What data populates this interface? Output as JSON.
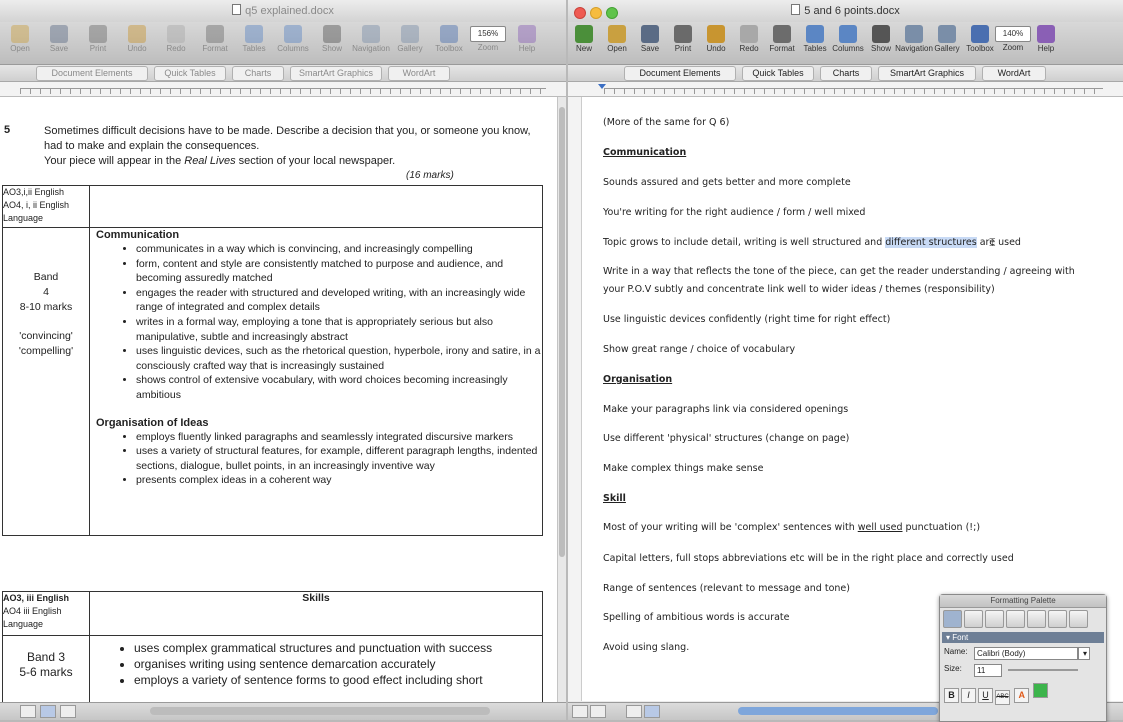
{
  "left_window": {
    "title": "q5 explained.docx",
    "toolbar": [
      {
        "label": "Open",
        "icon": "folder-icon"
      },
      {
        "label": "Save",
        "icon": "save-icon"
      },
      {
        "label": "Print",
        "icon": "print-icon"
      },
      {
        "label": "Undo",
        "icon": "undo-icon"
      },
      {
        "label": "Redo",
        "icon": "redo-icon"
      },
      {
        "label": "Format",
        "icon": "format-brush-icon"
      },
      {
        "label": "Tables",
        "icon": "tables-icon"
      },
      {
        "label": "Columns",
        "icon": "columns-icon"
      },
      {
        "label": "Show",
        "icon": "show-icon"
      },
      {
        "label": "Navigation",
        "icon": "navigation-icon"
      },
      {
        "label": "Gallery",
        "icon": "gallery-icon"
      },
      {
        "label": "Toolbox",
        "icon": "toolbox-icon"
      },
      {
        "label": "Zoom",
        "icon": "zoom-icon"
      },
      {
        "label": "Help",
        "icon": "help-icon"
      }
    ],
    "zoom_value": "156%",
    "ribbon_tabs": [
      "Document Elements",
      "Quick Tables",
      "Charts",
      "SmartArt Graphics",
      "WordArt"
    ],
    "question": {
      "number": "5",
      "line1": "Sometimes difficult decisions have to be made. Describe a decision that you, or someone you know, had to make and explain the consequences.",
      "line2_pre": "Your piece will appear in the ",
      "line2_italic": "Real Lives",
      "line2_post": " section of your local newspaper.",
      "marks": "(16 marks)"
    },
    "table1": {
      "assessment": [
        "AO3,i,ii English",
        "AO4, i, ii English",
        "Language"
      ],
      "band": [
        "Band",
        "4",
        "8-10 marks",
        "",
        "'convincing'",
        "'compelling'"
      ],
      "communication_heading": "Communication",
      "communication": [
        "communicates in a way which is convincing, and increasingly compelling",
        "form, content and style are consistently matched to purpose and audience, and becoming assuredly matched",
        "engages the reader with structured and developed writing, with an increasingly wide range of integrated and complex details",
        "writes in a formal way, employing a tone that is appropriately serious but also manipulative, subtle and increasingly abstract",
        "uses linguistic devices, such as the rhetorical question, hyperbole, irony and satire, in a consciously crafted way that is increasingly sustained",
        "shows control of extensive vocabulary, with word choices becoming increasingly ambitious"
      ],
      "organisation_heading": "Organisation of Ideas",
      "organisation": [
        "employs fluently linked paragraphs and seamlessly integrated discursive markers",
        "uses a variety of structural features, for example, different paragraph lengths, indented sections, dialogue, bullet points, in an increasingly inventive way",
        "presents complex ideas in a coherent way"
      ]
    },
    "table2": {
      "assessment": [
        "AO3, iii English",
        "AO4 iii English",
        "Language"
      ],
      "skills_heading": "Skills",
      "band": [
        "Band 3",
        "5-6 marks"
      ],
      "skills": [
        "uses complex grammatical structures and punctuation with success",
        "organises writing using sentence demarcation accurately",
        "employs a variety of sentence forms to good effect including short"
      ]
    }
  },
  "right_window": {
    "title": "5 and 6 points.docx",
    "toolbar": [
      {
        "label": "New",
        "icon": "new-document-icon"
      },
      {
        "label": "Open",
        "icon": "folder-icon"
      },
      {
        "label": "Save",
        "icon": "save-icon"
      },
      {
        "label": "Print",
        "icon": "print-icon"
      },
      {
        "label": "Undo",
        "icon": "undo-icon"
      },
      {
        "label": "Redo",
        "icon": "redo-icon"
      },
      {
        "label": "Format",
        "icon": "format-brush-icon"
      },
      {
        "label": "Tables",
        "icon": "tables-icon"
      },
      {
        "label": "Columns",
        "icon": "columns-icon"
      },
      {
        "label": "Show",
        "icon": "show-icon"
      },
      {
        "label": "Navigation",
        "icon": "navigation-icon"
      },
      {
        "label": "Gallery",
        "icon": "gallery-icon"
      },
      {
        "label": "Toolbox",
        "icon": "toolbox-icon"
      },
      {
        "label": "Zoom",
        "icon": "zoom-icon"
      },
      {
        "label": "Help",
        "icon": "help-icon"
      }
    ],
    "zoom_value": "140%",
    "ribbon_tabs": [
      "Document Elements",
      "Quick Tables",
      "Charts",
      "SmartArt Graphics",
      "WordArt"
    ],
    "lines": {
      "l0": "(More of the same for Q 6)",
      "communication": "Communication",
      "l1": "Sounds assured and gets better and more complete",
      "l2": "You're writing for the right audience / form / well mixed",
      "l3_pre": "Topic grows to include detail, writing is well structured and ",
      "l3_hl": "different structures",
      "l3_post": " are used",
      "l4a": "Write in a way that reflects the tone of the piece, can get the reader understanding / agreeing with",
      "l4b": "your P.O.V subtly and concentrate link well to wider ideas / themes (responsibility)",
      "l5": "Use linguistic devices confidently (right time for right effect)",
      "l6": "Show great range / choice of vocabulary",
      "organisation": "Organisation",
      "l7": "Make your paragraphs link via considered openings",
      "l8": "Use different 'physical' structures (change on page)",
      "l9": "Make complex things make sense",
      "skill": "Skill",
      "l10_pre": "Most of your writing will be 'complex' sentences with ",
      "l10_ul": "well used",
      "l10_post": " punctuation (!;)",
      "l11": "Capital letters, full stops abbreviations etc will be in the right place and correctly used",
      "l12": "Range of sentences (relevant to message and tone)",
      "l13": "Spelling of ambitious words is accurate",
      "l14": "Avoid using slang."
    }
  },
  "palette": {
    "title": "Formatting Palette",
    "section": "Font",
    "name_label": "Name:",
    "name_value": "Calibri (Body)",
    "size_label": "Size:",
    "size_value": "11",
    "buttons": [
      "B",
      "I",
      "U",
      "ABC"
    ]
  },
  "colors": {
    "highlight": "#c8daf5",
    "close": "#ef5a52",
    "minimize": "#f6bc3f",
    "zoom": "#5fc34a"
  }
}
